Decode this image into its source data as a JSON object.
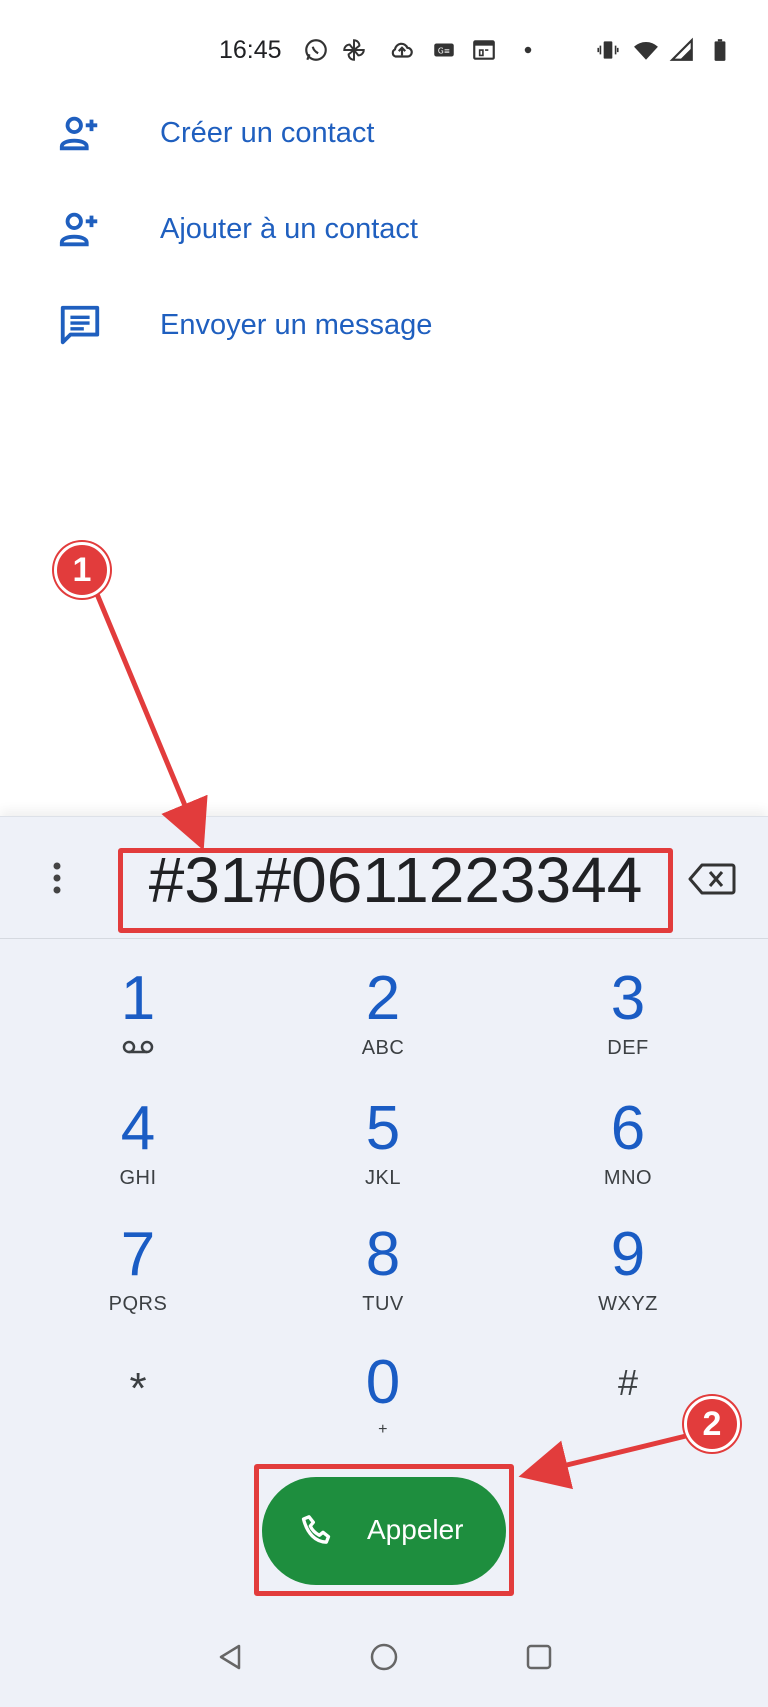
{
  "status_bar": {
    "time": "16:45",
    "icons": [
      "whatsapp-icon",
      "pinwheel-icon",
      "cloud-upload-icon",
      "gallery-icon",
      "calendar-icon",
      "dot-icon",
      "vibrate-icon",
      "wifi-icon",
      "signal-icon",
      "battery-icon"
    ]
  },
  "actions": [
    {
      "label": "Créer un contact",
      "icon": "add-person-icon"
    },
    {
      "label": "Ajouter à un contact",
      "icon": "add-person-icon"
    },
    {
      "label": "Envoyer un message",
      "icon": "message-icon"
    }
  ],
  "dialer": {
    "entered_number": "#31#0611223344",
    "keys": [
      {
        "digit": "1",
        "letters": ""
      },
      {
        "digit": "2",
        "letters": "ABC"
      },
      {
        "digit": "3",
        "letters": "DEF"
      },
      {
        "digit": "4",
        "letters": "GHI"
      },
      {
        "digit": "5",
        "letters": "JKL"
      },
      {
        "digit": "6",
        "letters": "MNO"
      },
      {
        "digit": "7",
        "letters": "PQRS"
      },
      {
        "digit": "8",
        "letters": "TUV"
      },
      {
        "digit": "9",
        "letters": "WXYZ"
      },
      {
        "digit": "*",
        "letters": ""
      },
      {
        "digit": "0",
        "letters": "+"
      },
      {
        "digit": "#",
        "letters": ""
      }
    ],
    "call_label": "Appeler"
  },
  "annotations": {
    "badge_1": "1",
    "badge_2": "2",
    "color": "#e23c3c"
  },
  "colors": {
    "accent_blue": "#1a5cc4",
    "call_green": "#1e8e3e",
    "dialer_bg": "#eef1f8"
  }
}
